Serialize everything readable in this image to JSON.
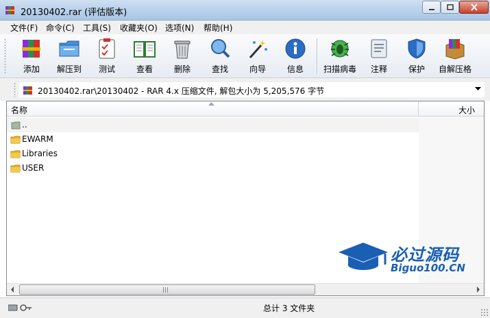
{
  "window": {
    "title": "20130402.rar (评估版本)",
    "icon": "winrar-books-icon"
  },
  "menu": [
    "文件(F)",
    "命令(C)",
    "工具(S)",
    "收藏夹(O)",
    "选项(N)",
    "帮助(H)"
  ],
  "toolbar": {
    "tools": [
      {
        "label": "添加",
        "icon": "add-archive-icon"
      },
      {
        "label": "解压到",
        "icon": "extract-folder-icon"
      },
      {
        "label": "测试",
        "icon": "test-checklist-icon"
      },
      {
        "label": "查看",
        "icon": "view-book-icon"
      },
      {
        "label": "删除",
        "icon": "trash-can-icon"
      },
      {
        "label": "查找",
        "icon": "magnifier-icon"
      },
      {
        "label": "向导",
        "icon": "magic-wand-icon"
      },
      {
        "label": "信息",
        "icon": "info-icon"
      },
      {
        "label": "扫描病毒",
        "icon": "virus-bug-icon"
      },
      {
        "label": "注释",
        "icon": "comment-notepad-icon"
      },
      {
        "label": "保护",
        "icon": "shield-icon"
      },
      {
        "label": "自解压格",
        "icon": "sfx-box-icon"
      }
    ]
  },
  "address": {
    "path": "20130402.rar\\20130402 - RAR 4.x 压缩文件, 解包大小为 5,205,576 字节"
  },
  "file_list": {
    "columns": {
      "name": "名称",
      "size": "大小"
    },
    "rows": [
      {
        "name": "..",
        "type": "up"
      },
      {
        "name": "EWARM",
        "type": "folder"
      },
      {
        "name": "Libraries",
        "type": "folder"
      },
      {
        "name": "USER",
        "type": "folder"
      }
    ]
  },
  "status": {
    "text": "总计 3 文件夹"
  },
  "watermark": {
    "cn": "必过源码",
    "en": "Biguo100.CN"
  },
  "colors": {
    "accent": "#1a5fb4",
    "folder": "#f3c94b",
    "close": "#c7412b"
  }
}
